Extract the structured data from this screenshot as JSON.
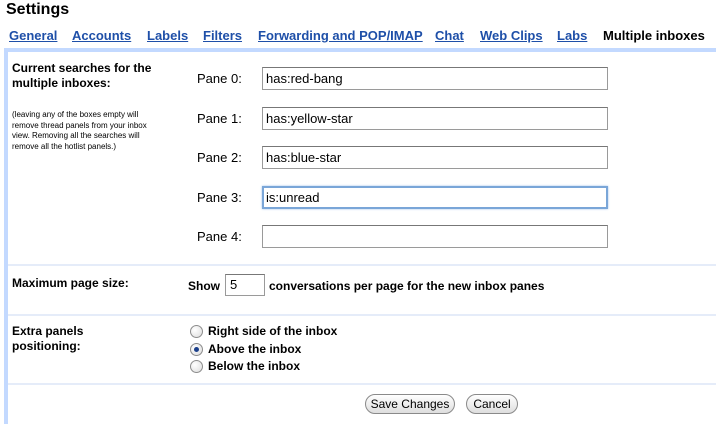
{
  "page": {
    "title": "Settings"
  },
  "tabs": [
    {
      "label": "General",
      "active": false
    },
    {
      "label": "Accounts",
      "active": false
    },
    {
      "label": "Labels",
      "active": false
    },
    {
      "label": "Filters",
      "active": false
    },
    {
      "label": "Forwarding and POP/IMAP",
      "active": false
    },
    {
      "label": "Chat",
      "active": false
    },
    {
      "label": "Web Clips",
      "active": false
    },
    {
      "label": "Labs",
      "active": false
    },
    {
      "label": "Multiple inboxes",
      "active": true
    }
  ],
  "searches": {
    "heading": "Current searches for the multiple inboxes:",
    "note": "(leaving any of the boxes empty will remove thread panels from your inbox view. Removing all the searches will remove all the hotlist panels.)",
    "panes": [
      {
        "label": "Pane 0:",
        "value": "has:red-bang",
        "focused": false
      },
      {
        "label": "Pane 1:",
        "value": "has:yellow-star",
        "focused": false
      },
      {
        "label": "Pane 2:",
        "value": "has:blue-star",
        "focused": false
      },
      {
        "label": "Pane 3:",
        "value": "is:unread",
        "focused": true
      },
      {
        "label": "Pane 4:",
        "value": "",
        "focused": false
      }
    ]
  },
  "page_size": {
    "heading": "Maximum page size:",
    "prefix": "Show",
    "value": "5",
    "suffix": "conversations per page for the new inbox panes"
  },
  "positioning": {
    "heading": "Extra panels positioning:",
    "options": [
      {
        "label": "Right side of the inbox",
        "checked": false
      },
      {
        "label": "Above the inbox",
        "checked": true
      },
      {
        "label": "Below the inbox",
        "checked": false
      }
    ]
  },
  "buttons": {
    "save": "Save Changes",
    "cancel": "Cancel"
  },
  "colors": {
    "tab_link": "#1e4fa8",
    "settings_border": "#c3d9ff",
    "radio_selected": "#1b3f8a"
  }
}
